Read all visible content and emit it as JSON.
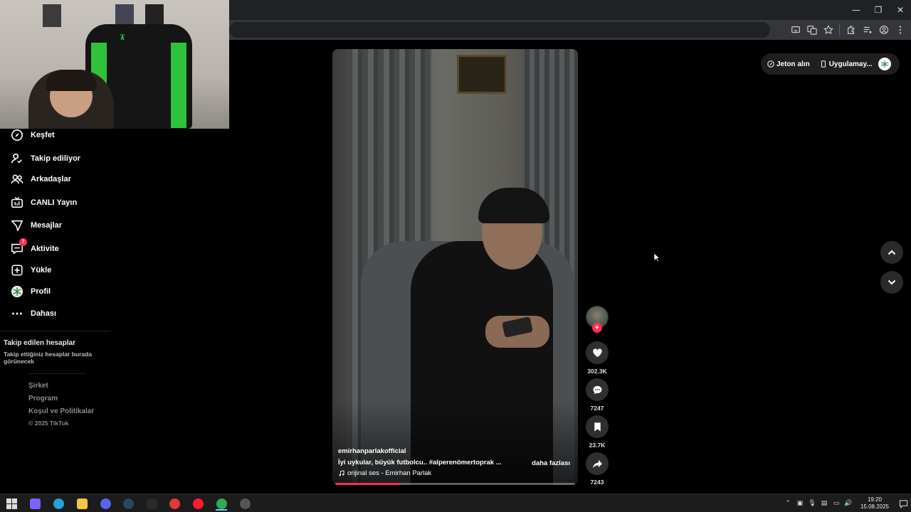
{
  "window": {
    "controls": [
      "—",
      "❐",
      "✕"
    ]
  },
  "toolbar": {
    "icons": [
      "screencast-icon",
      "translate-icon",
      "bookmark-star-icon",
      "extensions-icon",
      "media-icon",
      "profile-icon",
      "menu-icon"
    ]
  },
  "sidebar": {
    "items": [
      {
        "label": "Keşfet",
        "icon": "compass-icon"
      },
      {
        "label": "Takip ediliyor",
        "icon": "following-icon"
      },
      {
        "label": "Arkadaşlar",
        "icon": "friends-icon"
      },
      {
        "label": "CANLI Yayın",
        "icon": "live-icon"
      },
      {
        "label": "Mesajlar",
        "icon": "messages-icon"
      },
      {
        "label": "Aktivite",
        "icon": "activity-icon",
        "badge": "7"
      },
      {
        "label": "Yükle",
        "icon": "upload-icon"
      },
      {
        "label": "Profil",
        "icon": "profile-icon"
      },
      {
        "label": "Dahası",
        "icon": "more-icon"
      }
    ],
    "following_title": "Takip edilen hesaplar",
    "following_desc": "Takip ettiğiniz hesaplar burada görünecek",
    "footer_links": [
      "Şirket",
      "Program",
      "Koşul ve Politikalar"
    ],
    "copyright": "© 2025 TikTok"
  },
  "video": {
    "author": "emirhanparlakofficial",
    "caption": "İyi uykular, büyük futbolcu.. #alperenömertoprak  ...",
    "more_label": "daha fazlası",
    "music": "orijinal ses - Emirhan Parlak",
    "progress": 0.27
  },
  "actions": {
    "likes": "302.3K",
    "comments": "7247",
    "saves": "23.7K",
    "shares": "7243"
  },
  "topright": {
    "coins_label": "Jeton alın",
    "app_label": "Uygulamay..."
  },
  "taskbar": {
    "apps": [
      {
        "name": "start-icon",
        "color": "#3aa0f2"
      },
      {
        "name": "copilot-icon",
        "color": "#7b61ff"
      },
      {
        "name": "edge-icon",
        "color": "#1fa5d8"
      },
      {
        "name": "file-explorer-icon",
        "color": "#f5c542"
      },
      {
        "name": "discord-icon",
        "color": "#5865f2"
      },
      {
        "name": "steam-icon",
        "color": "#2a475e"
      },
      {
        "name": "epic-games-icon",
        "color": "#2a2a2a"
      },
      {
        "name": "app-red-icon",
        "color": "#e53935"
      },
      {
        "name": "opera-icon",
        "color": "#ff1b2d"
      },
      {
        "name": "chrome-icon",
        "color": "#34a853"
      },
      {
        "name": "app-monitor-icon",
        "color": "#555"
      }
    ],
    "time": "19:20",
    "date": "15.08.2025",
    "accent": "#60cdff"
  },
  "colors": {
    "brand": "#fe2c55",
    "background": "#000000"
  }
}
